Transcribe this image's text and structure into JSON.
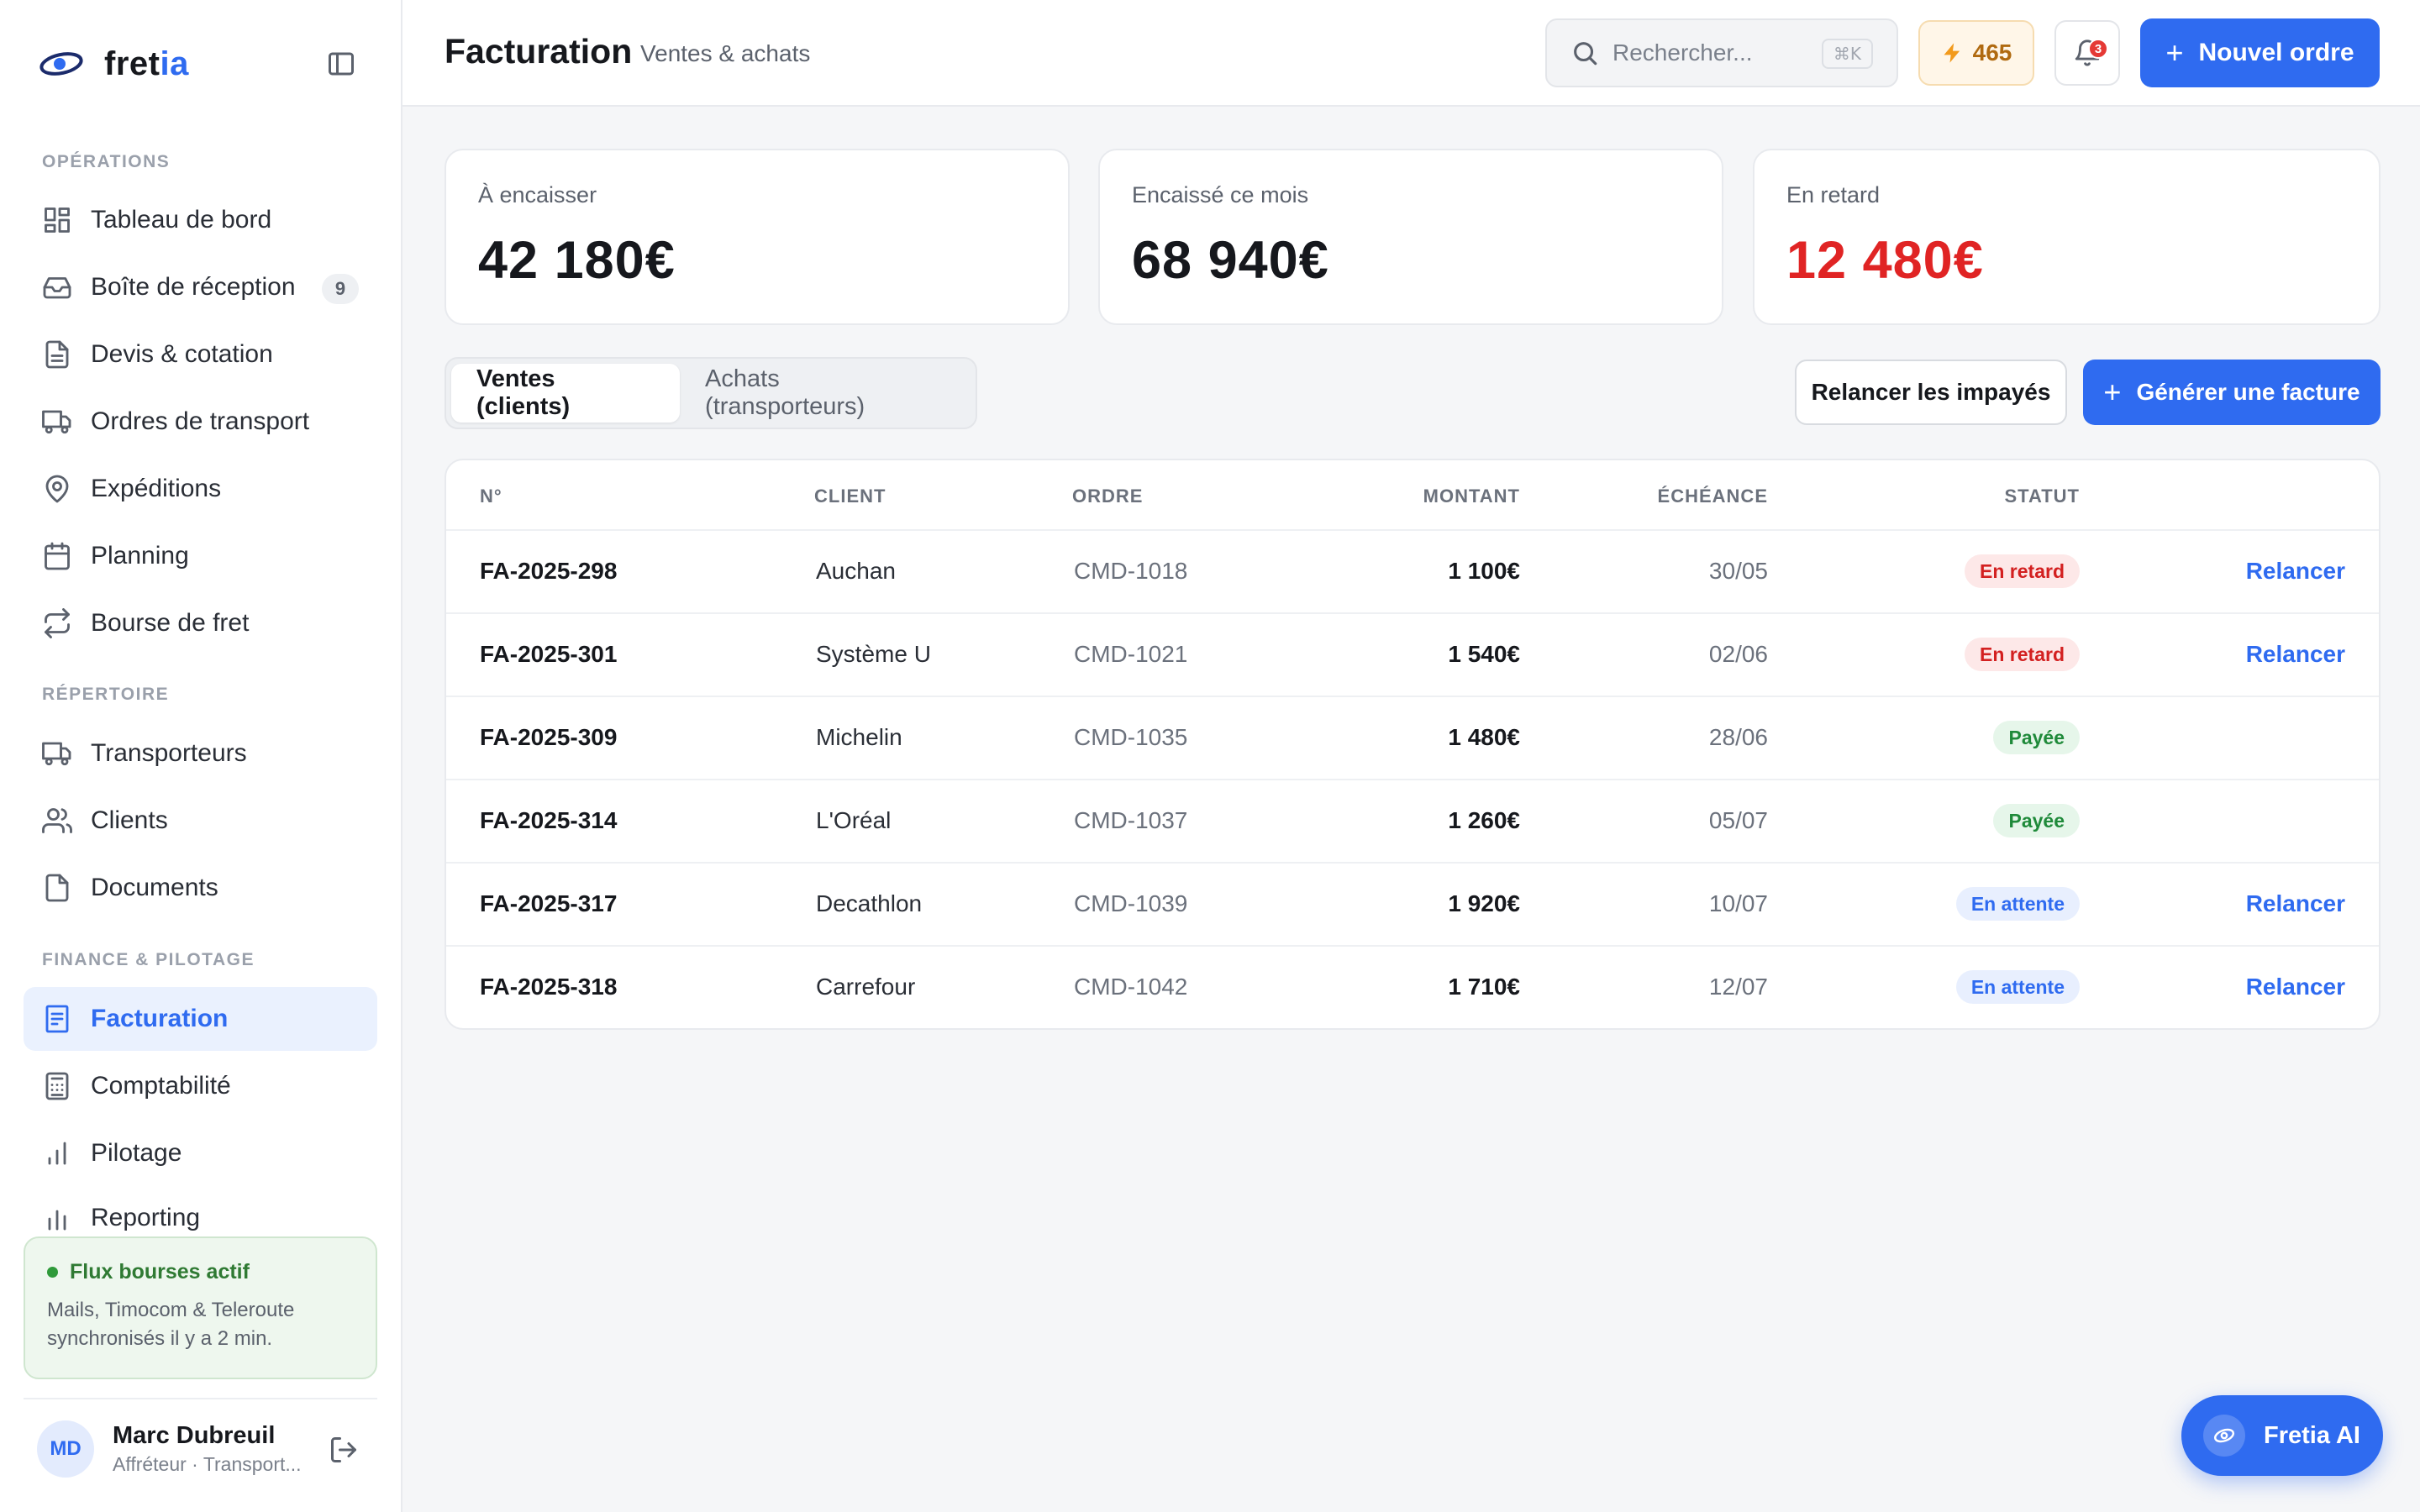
{
  "brand": {
    "name_main": "fret",
    "name_accent": "ia"
  },
  "sidebar": {
    "sections": [
      {
        "label": "OPÉRATIONS"
      },
      {
        "label": "RÉPERTOIRE"
      },
      {
        "label": "FINANCE & PILOTAGE"
      }
    ],
    "items": [
      {
        "label": "Tableau de bord",
        "icon": "dashboard-icon"
      },
      {
        "label": "Boîte de réception",
        "icon": "inbox-icon",
        "badge": "9"
      },
      {
        "label": "Devis & cotation",
        "icon": "document-icon"
      },
      {
        "label": "Ordres de transport",
        "icon": "truck-icon"
      },
      {
        "label": "Expéditions",
        "icon": "map-pin-icon"
      },
      {
        "label": "Planning",
        "icon": "calendar-icon"
      },
      {
        "label": "Bourse de fret",
        "icon": "swap-icon"
      },
      {
        "label": "Transporteurs",
        "icon": "truck-icon"
      },
      {
        "label": "Clients",
        "icon": "users-icon"
      },
      {
        "label": "Documents",
        "icon": "file-icon"
      },
      {
        "label": "Facturation",
        "icon": "invoice-icon",
        "active": true
      },
      {
        "label": "Comptabilité",
        "icon": "calculator-icon"
      },
      {
        "label": "Pilotage",
        "icon": "bar-chart-icon"
      },
      {
        "label": "Reporting",
        "icon": "bar-chart-icon"
      }
    ],
    "flux": {
      "title": "Flux bourses actif",
      "text": "Mails, Timocom & Teleroute synchronisés il y a 2 min."
    },
    "user": {
      "initials": "MD",
      "name": "Marc Dubreuil",
      "role": "Affréteur · Transport..."
    }
  },
  "header": {
    "title": "Facturation",
    "subtitle": "Ventes & achats",
    "search_placeholder": "Rechercher...",
    "search_shortcut": "⌘K",
    "credits": "465",
    "notifications": "3",
    "new_order_label": "Nouvel ordre"
  },
  "kpis": [
    {
      "label": "À encaisser",
      "value": "42 180€"
    },
    {
      "label": "Encaissé ce mois",
      "value": "68 940€"
    },
    {
      "label": "En retard",
      "value": "12 480€"
    }
  ],
  "tabs": [
    {
      "label": "Ventes (clients)",
      "active": true
    },
    {
      "label": "Achats (transporteurs)",
      "active": false
    }
  ],
  "actions": {
    "remind_unpaid": "Relancer les impayés",
    "generate_invoice": "Générer une facture"
  },
  "table": {
    "columns": [
      "N°",
      "CLIENT",
      "ORDRE",
      "MONTANT",
      "ÉCHÉANCE",
      "STATUT"
    ],
    "rows": [
      {
        "num": "FA-2025-298",
        "client": "Auchan",
        "order": "CMD-1018",
        "amount": "1 100€",
        "due": "30/05",
        "status": "En retard",
        "status_type": "late",
        "action": "Relancer"
      },
      {
        "num": "FA-2025-301",
        "client": "Système U",
        "order": "CMD-1021",
        "amount": "1 540€",
        "due": "02/06",
        "status": "En retard",
        "status_type": "late",
        "action": "Relancer"
      },
      {
        "num": "FA-2025-309",
        "client": "Michelin",
        "order": "CMD-1035",
        "amount": "1 480€",
        "due": "28/06",
        "status": "Payée",
        "status_type": "paid",
        "action": ""
      },
      {
        "num": "FA-2025-314",
        "client": "L'Oréal",
        "order": "CMD-1037",
        "amount": "1 260€",
        "due": "05/07",
        "status": "Payée",
        "status_type": "paid",
        "action": ""
      },
      {
        "num": "FA-2025-317",
        "client": "Decathlon",
        "order": "CMD-1039",
        "amount": "1 920€",
        "due": "10/07",
        "status": "En attente",
        "status_type": "pending",
        "action": "Relancer"
      },
      {
        "num": "FA-2025-318",
        "client": "Carrefour",
        "order": "CMD-1042",
        "amount": "1 710€",
        "due": "12/07",
        "status": "En attente",
        "status_type": "pending",
        "action": "Relancer"
      }
    ]
  },
  "ai_assistant": {
    "label": "Fretia AI"
  },
  "colors": {
    "accent": "#2f6bf0",
    "danger": "#e02424",
    "success": "#1f8a3a",
    "warning": "#f29a1c"
  }
}
